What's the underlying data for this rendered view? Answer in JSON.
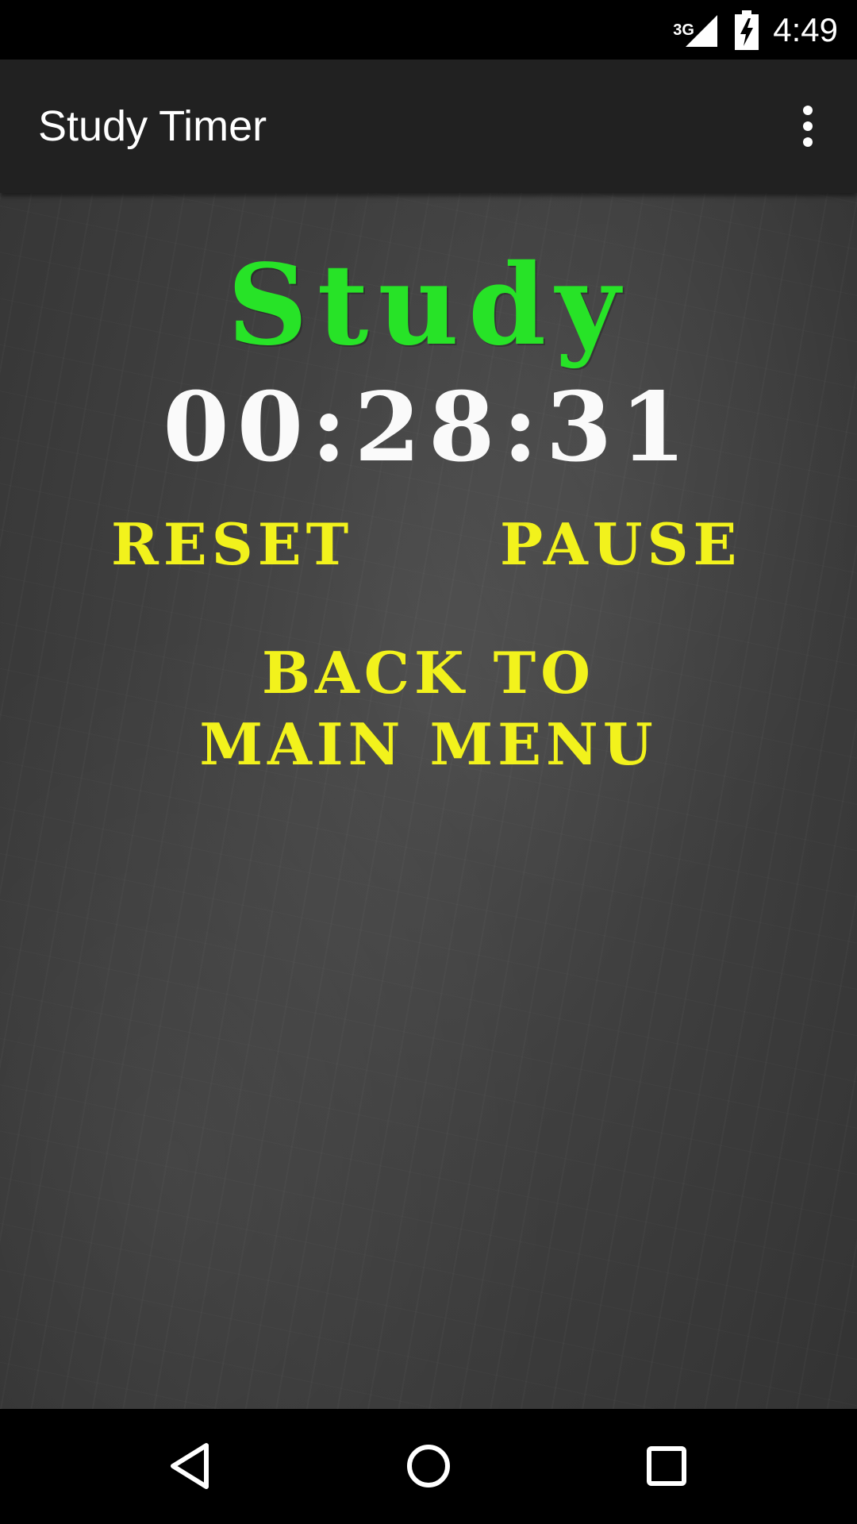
{
  "status_bar": {
    "network_label": "3G",
    "time": "4:49"
  },
  "app_bar": {
    "title": "Study Timer"
  },
  "timer_screen": {
    "mode_label": "Study",
    "time_display": "00:28:31",
    "reset_label": "RESET",
    "pause_label": "PAUSE",
    "main_menu_label": "BACK TO MAIN MENU"
  },
  "colors": {
    "mode_label": "#27e327",
    "buttons": "#f2f21c",
    "timer": "#fafafa",
    "app_bar": "#212121"
  },
  "icons": {
    "signal": "signal-icon",
    "battery": "battery-charging-icon",
    "overflow": "more-vert-icon",
    "back": "nav-back-icon",
    "home": "nav-home-icon",
    "recent": "nav-recent-icon"
  }
}
